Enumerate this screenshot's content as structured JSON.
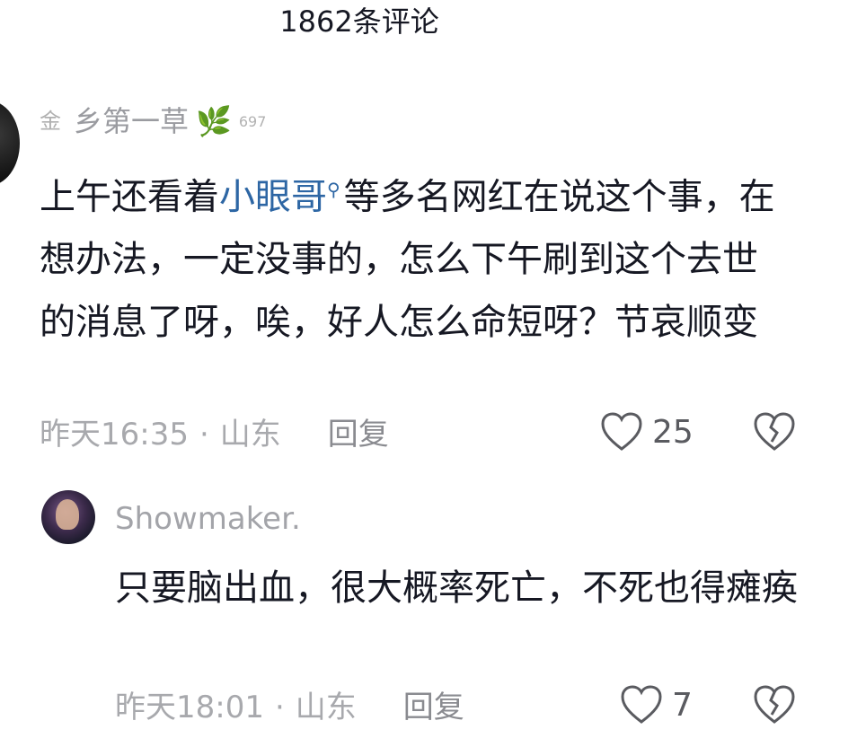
{
  "header": {
    "title": "1862条评论"
  },
  "comment": {
    "user_prefix_icon": "金",
    "username": "乡第一草",
    "leaf_icon": "🌿",
    "level": "697",
    "text_before": "上午还看着",
    "mention": "小眼哥",
    "text_after": "等多名网红在说这个事，在想办法，一定没事的，怎么下午刷到这个去世的消息了呀，唉，好人怎么命短呀？节哀顺变",
    "time": "昨天16:35",
    "separator": "·",
    "location": "山东",
    "reply_label": "回复",
    "likes": "25"
  },
  "reply": {
    "username": "Showmaker.",
    "text": "只要脑出血，很大概率死亡，不死也得瘫痪",
    "time": "昨天18:01",
    "separator": "·",
    "location": "山东",
    "reply_label": "回复",
    "likes": "7"
  },
  "colors": {
    "text": "#161823",
    "muted": "#a8a9ad",
    "mention": "#2d66a4",
    "icon": "#5a5b60"
  }
}
